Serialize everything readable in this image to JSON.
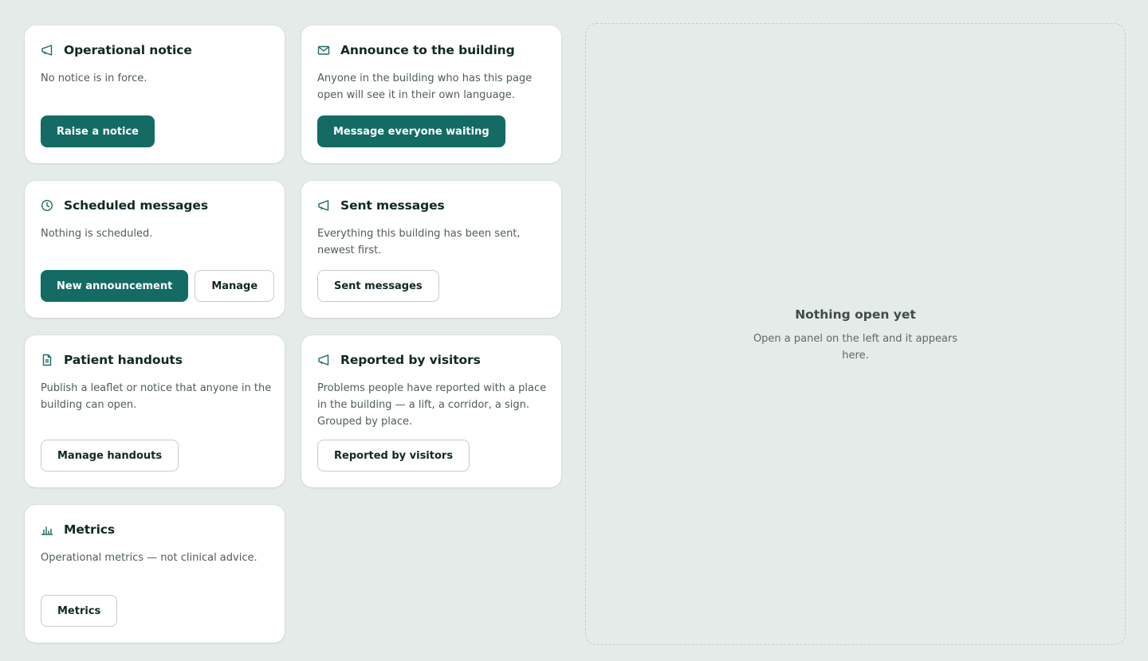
{
  "cards": {
    "operational_notice": {
      "icon": "megaphone-icon",
      "title": "Operational notice",
      "desc": "No notice is in force.",
      "primary_label": "Raise a notice"
    },
    "announce": {
      "icon": "envelope-icon",
      "title": "Announce to the building",
      "desc": "Anyone in the building who has this page open will see it in their own language.",
      "primary_label": "Message everyone waiting"
    },
    "scheduled": {
      "icon": "clock-icon",
      "title": "Scheduled messages",
      "desc": "Nothing is scheduled.",
      "primary_label": "New announcement",
      "secondary_label": "Manage"
    },
    "sent": {
      "icon": "megaphone-icon",
      "title": "Sent messages",
      "desc": "Everything this building has been sent, newest first.",
      "secondary_label": "Sent messages"
    },
    "handouts": {
      "icon": "document-icon",
      "title": "Patient handouts",
      "desc": "Publish a leaflet or notice that anyone in the building can open.",
      "secondary_label": "Manage handouts"
    },
    "reported": {
      "icon": "megaphone-icon",
      "title": "Reported by visitors",
      "desc": "Problems people have reported with a place in the building — a lift, a corridor, a sign. Grouped by place.",
      "secondary_label": "Reported by visitors"
    },
    "metrics": {
      "icon": "bar-chart-icon",
      "title": "Metrics",
      "desc": "Operational metrics — not clinical advice.",
      "secondary_label": "Metrics"
    }
  },
  "empty_state": {
    "title": "Nothing open yet",
    "desc": "Open a panel on the left and it appears here."
  },
  "colors": {
    "background": "#e4ebe8",
    "primary": "#136b64",
    "icon": "#1d6a62"
  }
}
